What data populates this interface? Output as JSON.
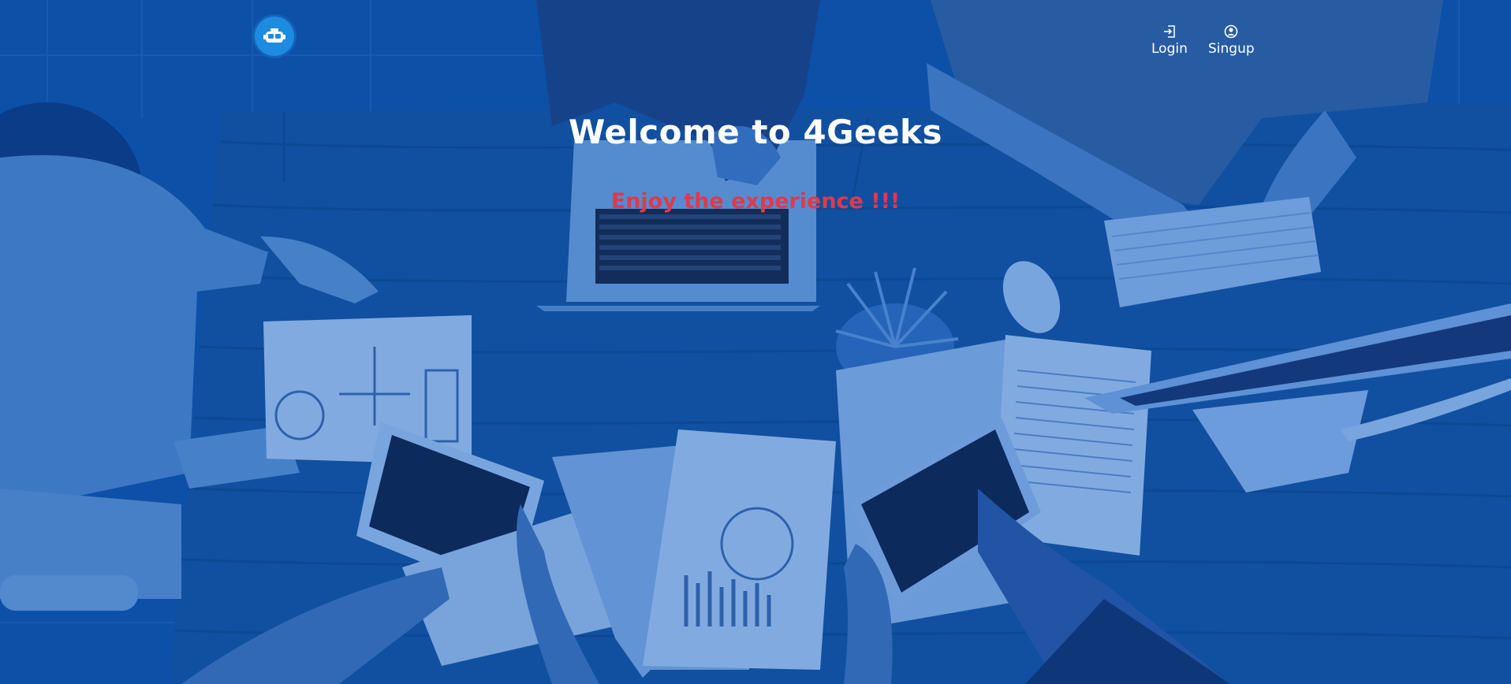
{
  "colors": {
    "overlay": "#0a4a9c",
    "title": "#ffffff",
    "subtitle": "#e0394d",
    "logo": "#1d8be0"
  },
  "navbar": {
    "logo_icon": "robot-logo-icon",
    "links": [
      {
        "label": "Login",
        "icon": "login-icon"
      },
      {
        "label": "Singup",
        "icon": "user-circle-icon"
      }
    ]
  },
  "hero": {
    "title": "Welcome to 4Geeks",
    "subtitle": "Enjoy the experience !!!"
  }
}
